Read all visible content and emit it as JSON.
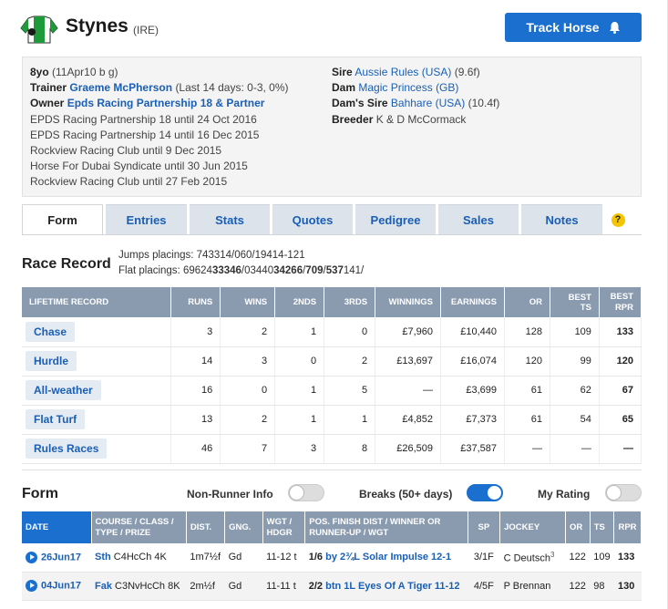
{
  "horse": {
    "name": "Stynes",
    "country": "(IRE)"
  },
  "track_button": {
    "label": "Track Horse",
    "icon": "bell-icon"
  },
  "info": {
    "age": "8yo",
    "age_detail": "(11Apr10 b g)",
    "trainer_label": "Trainer",
    "trainer": "Graeme McPherson",
    "trainer_stats": "(Last 14 days: 0-3, 0%)",
    "owner_label": "Owner",
    "owner": "Epds Racing Partnership 18 & Partner",
    "prev_owners": [
      "EPDS Racing Partnership 18 until 24 Oct 2016",
      "EPDS Racing Partnership 14 until 16 Dec 2015",
      "Rockview Racing Club until 9 Dec 2015",
      "Horse For Dubai Syndicate until 30 Jun 2015",
      "Rockview Racing Club until 27 Feb 2015"
    ],
    "sire_label": "Sire",
    "sire": "Aussie Rules",
    "sire_country": "(USA)",
    "sire_dist": "(9.6f)",
    "dam_label": "Dam",
    "dam": "Magic Princess",
    "dam_country": "(GB)",
    "damsire_label": "Dam's Sire",
    "damsire": "Bahhare",
    "damsire_country": "(USA)",
    "damsire_dist": "(10.4f)",
    "breeder_label": "Breeder",
    "breeder": "K & D McCormack"
  },
  "tabs": [
    "Form",
    "Entries",
    "Stats",
    "Quotes",
    "Pedigree",
    "Sales",
    "Notes"
  ],
  "help_icon": "?",
  "race_record": {
    "title": "Race Record",
    "jumps": "Jumps placings: 743314/060/19414-121",
    "flat_prefix": "Flat placings: 69624",
    "flat_b1": "33346",
    "flat_m1": "/03440",
    "flat_b2": "34266",
    "flat_m2": "/",
    "flat_b3": "709",
    "flat_m3": "/",
    "flat_b4": "537",
    "flat_end": "141/"
  },
  "lifetime": {
    "headers": [
      "LIFETIME RECORD",
      "RUNS",
      "WINS",
      "2NDS",
      "3RDS",
      "WINNINGS",
      "EARNINGS",
      "OR",
      "BEST TS",
      "BEST RPR"
    ],
    "rows": [
      {
        "type": "Chase",
        "runs": "3",
        "wins": "2",
        "seconds": "1",
        "thirds": "0",
        "winnings": "£7,960",
        "earnings": "£10,440",
        "or": "128",
        "ts": "109",
        "rpr": "133"
      },
      {
        "type": "Hurdle",
        "runs": "14",
        "wins": "3",
        "seconds": "0",
        "thirds": "2",
        "winnings": "£13,697",
        "earnings": "£16,074",
        "or": "120",
        "ts": "99",
        "rpr": "120"
      },
      {
        "type": "All-weather",
        "runs": "16",
        "wins": "0",
        "seconds": "1",
        "thirds": "5",
        "winnings": "—",
        "earnings": "£3,699",
        "or": "61",
        "ts": "62",
        "rpr": "67"
      },
      {
        "type": "Flat Turf",
        "runs": "13",
        "wins": "2",
        "seconds": "1",
        "thirds": "1",
        "winnings": "£4,852",
        "earnings": "£7,373",
        "or": "61",
        "ts": "54",
        "rpr": "65"
      },
      {
        "type": "Rules Races",
        "runs": "46",
        "wins": "7",
        "seconds": "3",
        "thirds": "8",
        "winnings": "£26,509",
        "earnings": "£37,587",
        "or": "—",
        "ts": "—",
        "rpr": "—"
      }
    ]
  },
  "form": {
    "title": "Form",
    "toggles": [
      {
        "label": "Non-Runner Info",
        "on": false
      },
      {
        "label": "Breaks (50+ days)",
        "on": true
      },
      {
        "label": "My Rating",
        "on": false
      }
    ],
    "headers": [
      "DATE",
      "COURSE / CLASS / TYPE / PRIZE",
      "DIST.",
      "GNG.",
      "WGT / HDGR",
      "POS. FINISH DIST / WINNER OR RUNNER-UP / WGT",
      "SP",
      "JOCKEY",
      "OR",
      "TS",
      "RPR"
    ],
    "rows": [
      {
        "date": "26Jun17",
        "course": "Sth",
        "class": "C4HcCh 4K",
        "dist": "1m7½f",
        "going": "Gd",
        "wgt": "11-12 t",
        "pos": "1/6",
        "result": "by 2¾L Solar Impulse 12-1",
        "sp": "3/1F",
        "jockey": "C Deutsch",
        "claim": "3",
        "or": "122",
        "ts": "109",
        "rpr": "133"
      },
      {
        "date": "04Jun17",
        "course": "Fak",
        "class": "C3NvHcCh 8K",
        "dist": "2m½f",
        "going": "Gd",
        "wgt": "11-11 t",
        "pos": "2/2",
        "result": "btn 1L Eyes Of A Tiger 11-12",
        "sp": "4/5F",
        "jockey": "P Brennan",
        "claim": "",
        "or": "122",
        "ts": "98",
        "rpr": "130"
      }
    ]
  }
}
